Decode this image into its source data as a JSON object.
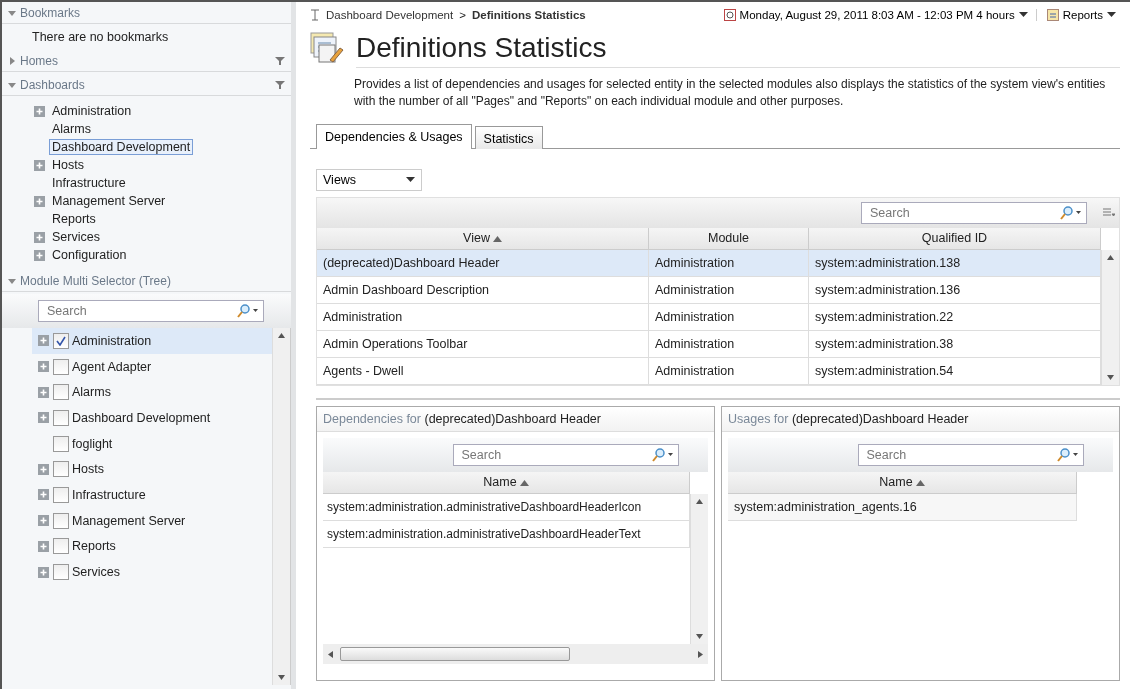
{
  "sidebar": {
    "sections": [
      {
        "kind": "message",
        "title": "Bookmarks",
        "expanded": true,
        "message": "There are no bookmarks"
      },
      {
        "title": "Homes",
        "expanded": false,
        "menu": true
      },
      {
        "kind": "tree",
        "title": "Dashboards",
        "expanded": true,
        "menu": true,
        "items": [
          {
            "label": "Administration",
            "expandable": true,
            "selected": false
          },
          {
            "label": "Alarms",
            "expandable": false,
            "selected": false
          },
          {
            "label": "Dashboard Development",
            "expandable": false,
            "selected": true
          },
          {
            "label": "Hosts",
            "expandable": true,
            "selected": false
          },
          {
            "label": "Infrastructure",
            "expandable": false,
            "selected": false
          },
          {
            "label": "Management Server",
            "expandable": true,
            "selected": false
          },
          {
            "label": "Reports",
            "expandable": false,
            "selected": false
          },
          {
            "label": "Services",
            "expandable": true,
            "selected": false
          },
          {
            "label": "Configuration",
            "expandable": true,
            "selected": false
          }
        ]
      },
      {
        "kind": "checklist",
        "title": "Module Multi Selector (Tree)",
        "expanded": true,
        "search": {
          "placeholder": "Search"
        },
        "items": [
          {
            "label": "Administration",
            "expandable": true,
            "checked": true,
            "selected": true
          },
          {
            "label": "Agent Adapter",
            "expandable": true,
            "checked": false,
            "selected": false
          },
          {
            "label": "Alarms",
            "expandable": true,
            "checked": false,
            "selected": false
          },
          {
            "label": "Dashboard Development",
            "expandable": true,
            "checked": false,
            "selected": false
          },
          {
            "label": "foglight",
            "expandable": false,
            "checked": false,
            "selected": false
          },
          {
            "label": "Hosts",
            "expandable": true,
            "checked": false,
            "selected": false
          },
          {
            "label": "Infrastructure",
            "expandable": true,
            "checked": false,
            "selected": false
          },
          {
            "label": "Management Server",
            "expandable": true,
            "checked": false,
            "selected": false
          },
          {
            "label": "Reports",
            "expandable": true,
            "checked": false,
            "selected": false
          },
          {
            "label": "Services",
            "expandable": true,
            "checked": false,
            "selected": false
          }
        ]
      }
    ]
  },
  "breadcrumb": {
    "separator": ">",
    "items": [
      "Dashboard Development",
      "Definitions Statistics"
    ]
  },
  "time_range": "Monday, August 29, 2011 8:03 AM - 12:03 PM 4 hours",
  "reports_menu": "Reports",
  "title": "Definitions Statistics",
  "description": "Provides a list of dependencies and usages for selected entity in the selected modules also displays the statistics of the system view's entities with the number of all \"Pages\" and \"Reports\" on each individual module and other purposes.",
  "tabs": [
    {
      "label": "Dependencies & Usages",
      "selected": true
    },
    {
      "label": "Statistics",
      "selected": false
    }
  ],
  "view_select": "Views",
  "table": {
    "search": {
      "placeholder": "Search"
    },
    "columns": [
      {
        "label": "View",
        "sorted": true
      },
      {
        "label": "Module",
        "sorted": false
      },
      {
        "label": "Qualified ID",
        "sorted": false
      }
    ],
    "rows": [
      {
        "cells": [
          "(deprecated)Dashboard Header",
          "Administration",
          "system:administration.138"
        ],
        "selected": true
      },
      {
        "cells": [
          "Admin Dashboard Description",
          "Administration",
          "system:administration.136"
        ],
        "selected": false
      },
      {
        "cells": [
          "Administration",
          "Administration",
          "system:administration.22"
        ],
        "selected": false
      },
      {
        "cells": [
          "Admin Operations Toolbar",
          "Administration",
          "system:administration.38"
        ],
        "selected": false
      },
      {
        "cells": [
          "Agents - Dwell",
          "Administration",
          "system:administration.54"
        ],
        "selected": false
      }
    ]
  },
  "panels": [
    {
      "kind": "scrolling",
      "title_prefix": "Dependencies for",
      "title_subject": "(deprecated)Dashboard Header",
      "search": {
        "placeholder": "Search"
      },
      "column": {
        "label": "Name",
        "sorted": true
      },
      "rows": [
        "system:administration.administrativeDashboardHeaderIcon",
        "system:administration.administrativeDashboardHeaderText"
      ]
    },
    {
      "kind": "plain",
      "title_prefix": "Usages for",
      "title_subject": "(deprecated)Dashboard Header",
      "search": {
        "placeholder": "Search"
      },
      "column": {
        "label": "Name",
        "sorted": true
      },
      "rows": [
        "system:administration_agents.16"
      ]
    }
  ]
}
